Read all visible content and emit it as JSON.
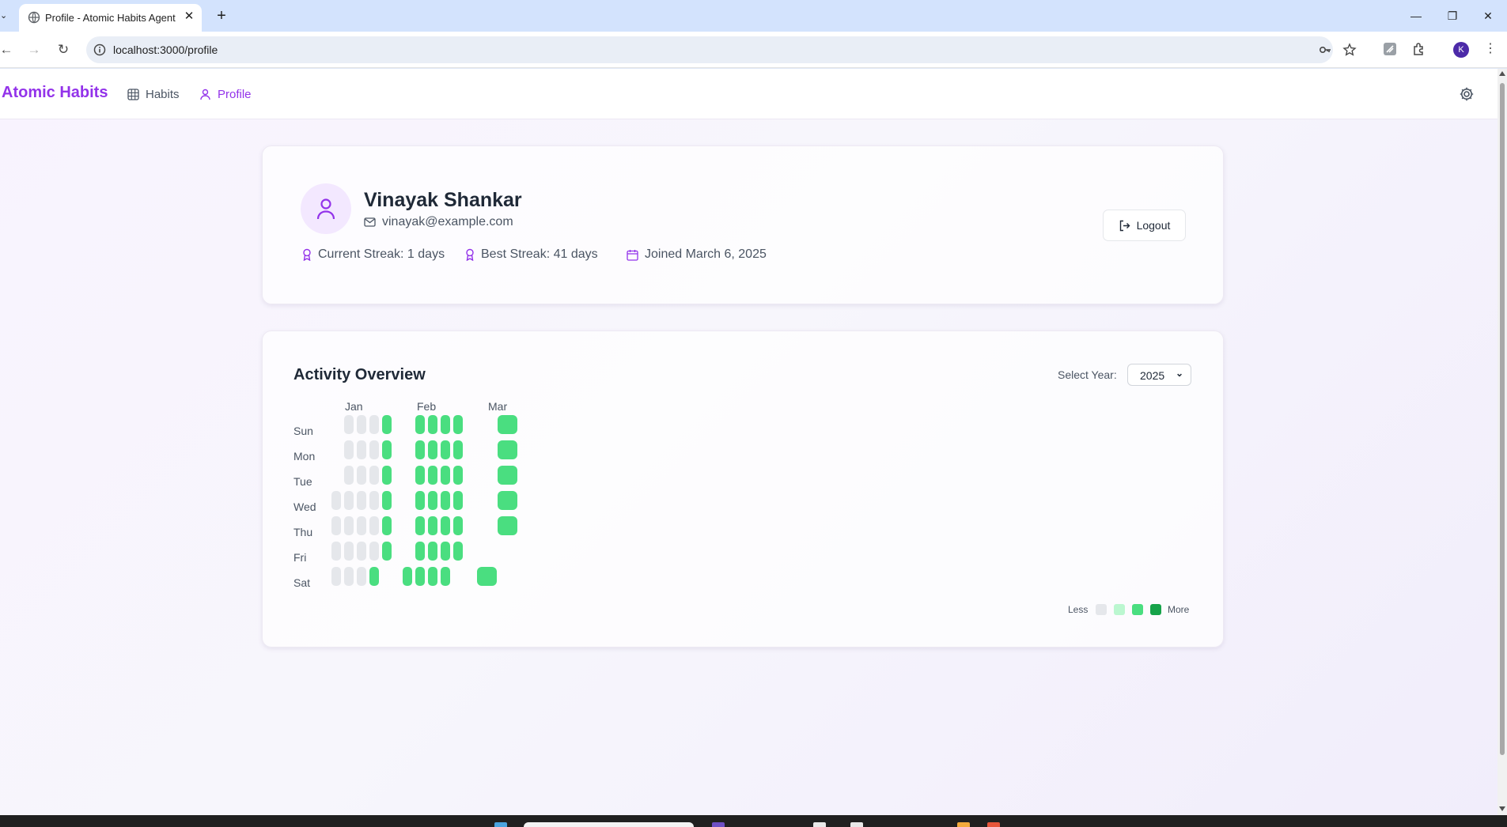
{
  "browser": {
    "tab_title": "Profile - Atomic Habits Agent",
    "url": "localhost:3000/profile",
    "profile_initial": "K"
  },
  "app": {
    "brand": "Atomic Habits",
    "nav": [
      {
        "label": "Habits",
        "icon": "grid-icon",
        "active": false
      },
      {
        "label": "Profile",
        "icon": "user-icon",
        "active": true
      }
    ],
    "accent_color": "#9333ea"
  },
  "profile": {
    "name": "Vinayak Shankar",
    "email": "vinayak@example.com",
    "current_streak": "Current Streak: 1 days",
    "best_streak": "Best Streak: 41 days",
    "joined": "Joined March 6, 2025",
    "logout_label": "Logout"
  },
  "activity": {
    "title": "Activity Overview",
    "year_label": "Select Year:",
    "year_value": "2025",
    "months": [
      "Jan",
      "Feb",
      "Mar"
    ],
    "days": [
      "Sun",
      "Mon",
      "Tue",
      "Wed",
      "Thu",
      "Fri",
      "Sat"
    ],
    "legend_less": "Less",
    "legend_more": "More",
    "legend_colors": [
      "#e5e7eb",
      "#bbf7d0",
      "#4ade80",
      "#16a34a"
    ],
    "heatmap_levels_by_week": [
      [
        null,
        null,
        null,
        0,
        0,
        0,
        0
      ],
      [
        0,
        0,
        0,
        0,
        0,
        0,
        0
      ],
      [
        0,
        0,
        0,
        0,
        0,
        0,
        0
      ],
      [
        0,
        0,
        0,
        0,
        0,
        0,
        2
      ],
      [
        2,
        2,
        2,
        2,
        2,
        2,
        null
      ],
      [
        null,
        null,
        null,
        null,
        null,
        null,
        2
      ],
      [
        2,
        2,
        2,
        2,
        2,
        2,
        2
      ],
      [
        2,
        2,
        2,
        2,
        2,
        2,
        2
      ],
      [
        2,
        2,
        2,
        2,
        2,
        2,
        2
      ],
      [
        2,
        2,
        2,
        2,
        2,
        2,
        null
      ],
      [
        null,
        null,
        null,
        null,
        null,
        null,
        2
      ],
      [
        2,
        2,
        2,
        2,
        2,
        null,
        null
      ]
    ]
  }
}
